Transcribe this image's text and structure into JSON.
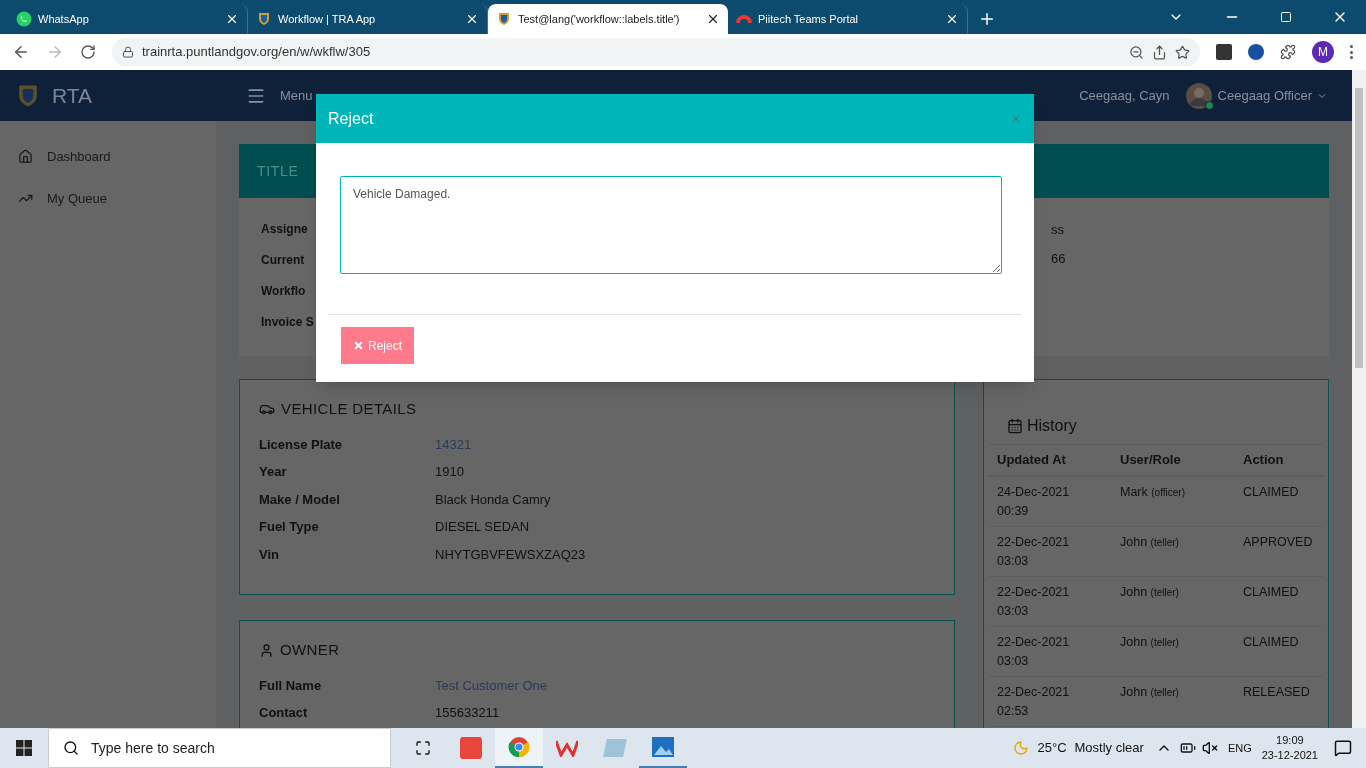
{
  "browser": {
    "tabs": [
      {
        "title": "WhatsApp",
        "selected": false
      },
      {
        "title": "Workflow | TRA App",
        "selected": false
      },
      {
        "title": "Test@lang('workflow::labels.title')",
        "selected": true
      },
      {
        "title": "Piitech Teams Portal",
        "selected": false
      }
    ],
    "url": "trainrta.puntlandgov.org/en/w/wkflw/305",
    "profile": "M"
  },
  "header": {
    "brand": "RTA",
    "menu": "Menu",
    "user_name": "Ceegaag, Cayn",
    "role": "Ceegaag Officer"
  },
  "sidebar": {
    "items": [
      {
        "label": "Dashboard"
      },
      {
        "label": "My Queue"
      }
    ]
  },
  "title_card": {
    "heading": "TITLE",
    "labels": [
      "Assigne",
      "Current",
      "Workflo",
      "Invoice S"
    ],
    "values": [
      "ss",
      "66"
    ]
  },
  "vehicle": {
    "heading": "VEHICLE DETAILS",
    "rows": [
      {
        "label": "License Plate",
        "value": "14321",
        "link": true
      },
      {
        "label": "Year",
        "value": "1910",
        "link": false
      },
      {
        "label": "Make / Model",
        "value": "Black Honda Camry",
        "link": false
      },
      {
        "label": "Fuel Type",
        "value": "DIESEL SEDAN",
        "link": false
      },
      {
        "label": "Vin",
        "value": "NHYTGBVFEWSXZAQ23",
        "link": false
      }
    ]
  },
  "owner": {
    "heading": "OWNER",
    "rows": [
      {
        "label": "Full Name",
        "value": "Test Customer One",
        "link": true
      },
      {
        "label": "Contact",
        "value": "155633211",
        "link": false
      }
    ]
  },
  "history": {
    "heading": "History",
    "columns": [
      "Updated At",
      "User/Role",
      "Action"
    ],
    "rows": [
      {
        "date": "24-Dec-2021",
        "time": "00:39",
        "user": "Mark",
        "role": "(officer)",
        "action": "CLAIMED"
      },
      {
        "date": "22-Dec-2021",
        "time": "03:03",
        "user": "John",
        "role": "(teller)",
        "action": "APPROVED"
      },
      {
        "date": "22-Dec-2021",
        "time": "03:03",
        "user": "John",
        "role": "(teller)",
        "action": "CLAIMED"
      },
      {
        "date": "22-Dec-2021",
        "time": "03:03",
        "user": "John",
        "role": "(teller)",
        "action": "CLAIMED"
      },
      {
        "date": "22-Dec-2021",
        "time": "02:53",
        "user": "John",
        "role": "(teller)",
        "action": "RELEASED"
      }
    ]
  },
  "modal": {
    "title": "Reject",
    "reason": "Vehicle Damaged.",
    "button": "Reject"
  },
  "taskbar": {
    "search_placeholder": "Type here to search",
    "temperature": "25°C",
    "weather": "Mostly clear",
    "language": "ENG",
    "time": "19:09",
    "date": "23-12-2021"
  }
}
